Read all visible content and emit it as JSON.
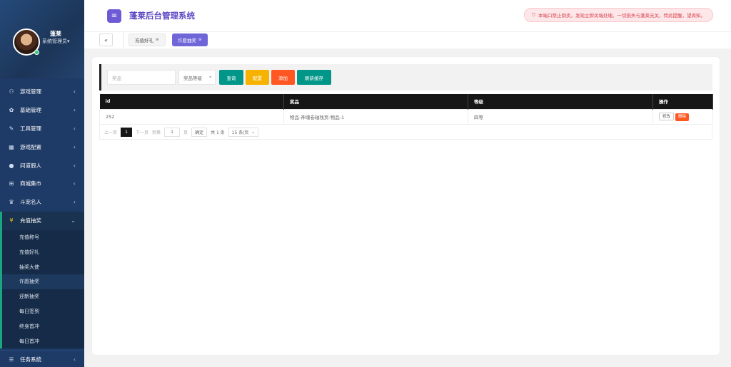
{
  "sidebar": {
    "user_name": "蓬莱",
    "user_role": "系统管理员▾",
    "menu": [
      {
        "icon": "gamepad-icon",
        "glyph": "⚇",
        "label": "游戏管理"
      },
      {
        "icon": "gear-icon",
        "glyph": "✿",
        "label": "基础管理"
      },
      {
        "icon": "wrench-icon",
        "glyph": "✎",
        "label": "工具管理"
      },
      {
        "icon": "table-icon",
        "glyph": "▦",
        "label": "游戏配置"
      },
      {
        "icon": "user-icon",
        "glyph": "●",
        "label": "问道假人"
      },
      {
        "icon": "cart-icon",
        "glyph": "⊞",
        "label": "商城集市"
      },
      {
        "icon": "trophy-icon",
        "glyph": "♛",
        "label": "斗宠名人"
      }
    ],
    "open_menu": {
      "icon": "yen-icon",
      "glyph": "¥",
      "label": "充值抽奖"
    },
    "submenu": [
      "充值称号",
      "充值好礼",
      "抽奖大使",
      "许愿抽奖",
      "迎新抽奖",
      "每日签到",
      "终身首冲",
      "每日首冲"
    ],
    "bottom_menu": {
      "icon": "list-icon",
      "glyph": "☰",
      "label": "任务系统"
    }
  },
  "header": {
    "title": "蓬莱后台管理系统",
    "notice": "本端口禁止倒卖，发现立即关端处理。一切损失与蓬莱无关，特此提醒，望周知。"
  },
  "tabs": {
    "collapse": "«",
    "items": [
      {
        "label": "充值好礼",
        "close": "⊗"
      },
      {
        "label": "许愿抽奖",
        "close": "⊗"
      }
    ]
  },
  "toolbar": {
    "name_placeholder": "奖品",
    "level_select": "奖品等级",
    "query": "查询",
    "config": "配置",
    "add": "添加",
    "refresh": "刷新缓存"
  },
  "table": {
    "headers": [
      "id",
      "奖品",
      "等级",
      "操作"
    ],
    "rows": [
      {
        "id": "252",
        "prize": "物品-神魂卷轴残页-物品-1",
        "level": "四等",
        "edit": "修改",
        "delete": "删除"
      }
    ]
  },
  "pager": {
    "prev": "上一页",
    "current": "1",
    "next": "下一页",
    "goto": "到第",
    "page_input": "1",
    "page_unit": "页",
    "confirm": "确定",
    "total": "共 1 条",
    "per_page": "15 条/页"
  },
  "colors": {
    "sidebar": "#1e3a66",
    "accent": "#6f5ad6",
    "teal": "#009688",
    "orange": "#ff5722",
    "yellow": "#f7b200"
  }
}
